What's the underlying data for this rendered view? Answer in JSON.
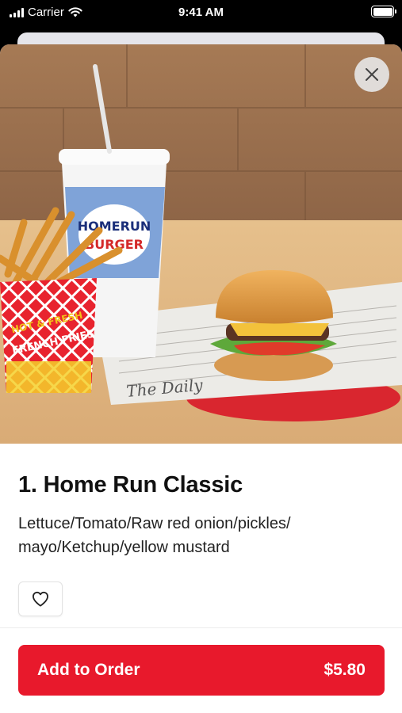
{
  "status_bar": {
    "carrier": "Carrier",
    "time": "9:41 AM"
  },
  "hero_image": {
    "cup_brand_top": "HOMERUN",
    "cup_brand_bottom": "BURGER",
    "fries_label_top": "HOT & FRESH",
    "fries_label_bottom": "FRENCH FRIES",
    "paper_print": "The Daily"
  },
  "item": {
    "title": "1. Home Run Classic",
    "description": "Lettuce/Tomato/Raw red onion/pickles/ mayo/Ketchup/yellow mustard"
  },
  "actions": {
    "add_label": "Add to Order",
    "price": "$5.80"
  },
  "colors": {
    "accent": "#e8192c",
    "close_bg": "#e5e5e5"
  },
  "icons": {
    "close": "close-icon",
    "favorite": "heart-outline-icon"
  }
}
